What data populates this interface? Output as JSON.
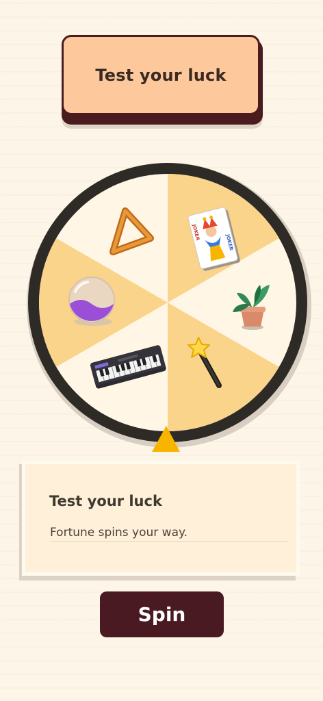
{
  "header": {
    "title_button": "Test your luck"
  },
  "wheel": {
    "segments": [
      {
        "item": "triangle-icon",
        "color": "#fff6e6"
      },
      {
        "item": "joker-card-icon",
        "color": "#fbd48c"
      },
      {
        "item": "plant-icon",
        "color": "#fff6e6"
      },
      {
        "item": "magic-wand-icon",
        "color": "#fbd48c"
      },
      {
        "item": "keyboard-icon",
        "color": "#fff6e6"
      },
      {
        "item": "crystal-ball-icon",
        "color": "#fbd48c"
      }
    ],
    "joker_card": {
      "left_text": "JOKER",
      "right_text": "JOKER"
    },
    "pointer_color": "#f7b500",
    "rim_color": "#2e2b27"
  },
  "card": {
    "title": "Test your luck",
    "text": "Fortune spins your way."
  },
  "spin_button": {
    "label": "Spin"
  },
  "colors": {
    "background": "#fdf6e8",
    "accent": "#4a1a22",
    "header_fill": "#fdc99c",
    "card_fill": "#fff0d9"
  }
}
